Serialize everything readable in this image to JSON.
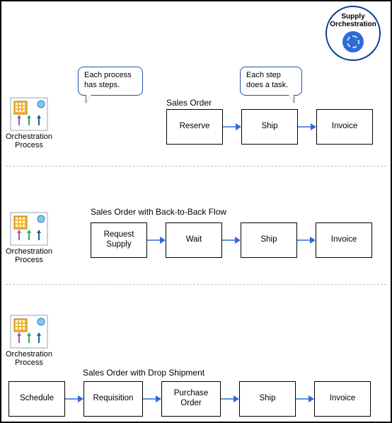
{
  "badge": {
    "line1": "Supply",
    "line2": "Orchestration"
  },
  "bubbles": {
    "processHasSteps": "Each process has steps.",
    "stepDoesTask": "Each step does a task."
  },
  "opLabel": "Orchestration\nProcess",
  "flows": {
    "salesOrder": {
      "title": "Sales Order",
      "steps": [
        "Reserve",
        "Ship",
        "Invoice"
      ]
    },
    "b2b": {
      "title": "Sales Order with Back-to-Back Flow",
      "steps": [
        "Request Supply",
        "Wait",
        "Ship",
        "Invoice"
      ]
    },
    "drop": {
      "title": "Sales Order with Drop Shipment",
      "steps": [
        "Schedule",
        "Requisition",
        "Purchase Order",
        "Ship",
        "Invoice"
      ]
    }
  }
}
